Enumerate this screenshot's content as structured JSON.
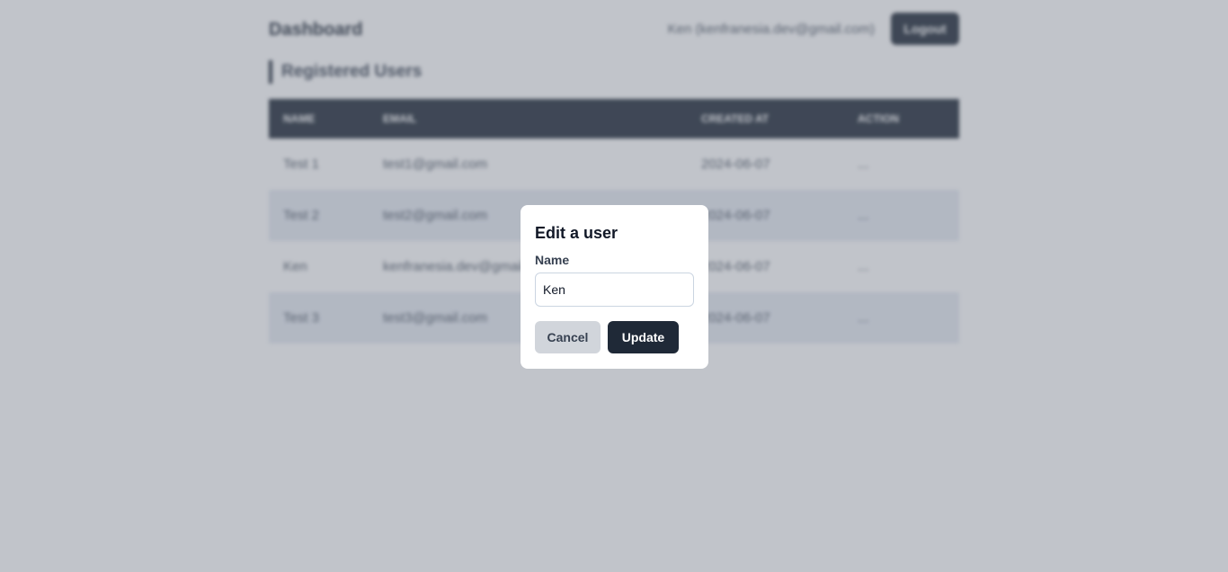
{
  "header": {
    "title": "Dashboard",
    "user": "Ken (kenfranesia.dev@gmail.com)",
    "logout_label": "Logout"
  },
  "section": {
    "title": "Registered Users"
  },
  "table": {
    "headers": [
      "Name",
      "Email",
      "Created At",
      "Action"
    ],
    "rows": [
      {
        "name": "Test 1",
        "email": "test1@gmail.com",
        "created": "2024-06-07",
        "action": "..."
      },
      {
        "name": "Test 2",
        "email": "test2@gmail.com",
        "created": "2024-06-07",
        "action": "..."
      },
      {
        "name": "Ken",
        "email": "kenfranesia.dev@gmail.com",
        "created": "2024-06-07",
        "action": "..."
      },
      {
        "name": "Test 3",
        "email": "test3@gmail.com",
        "created": "2024-06-07",
        "action": "..."
      }
    ]
  },
  "modal": {
    "title": "Edit a user",
    "name_label": "Name",
    "name_value": "Ken",
    "cancel_label": "Cancel",
    "update_label": "Update"
  },
  "colors": {
    "primary": "#1f2937",
    "overlay": "#6b7280",
    "row_alt": "#e5eaf2",
    "cancel_bg": "#d1d5db"
  }
}
